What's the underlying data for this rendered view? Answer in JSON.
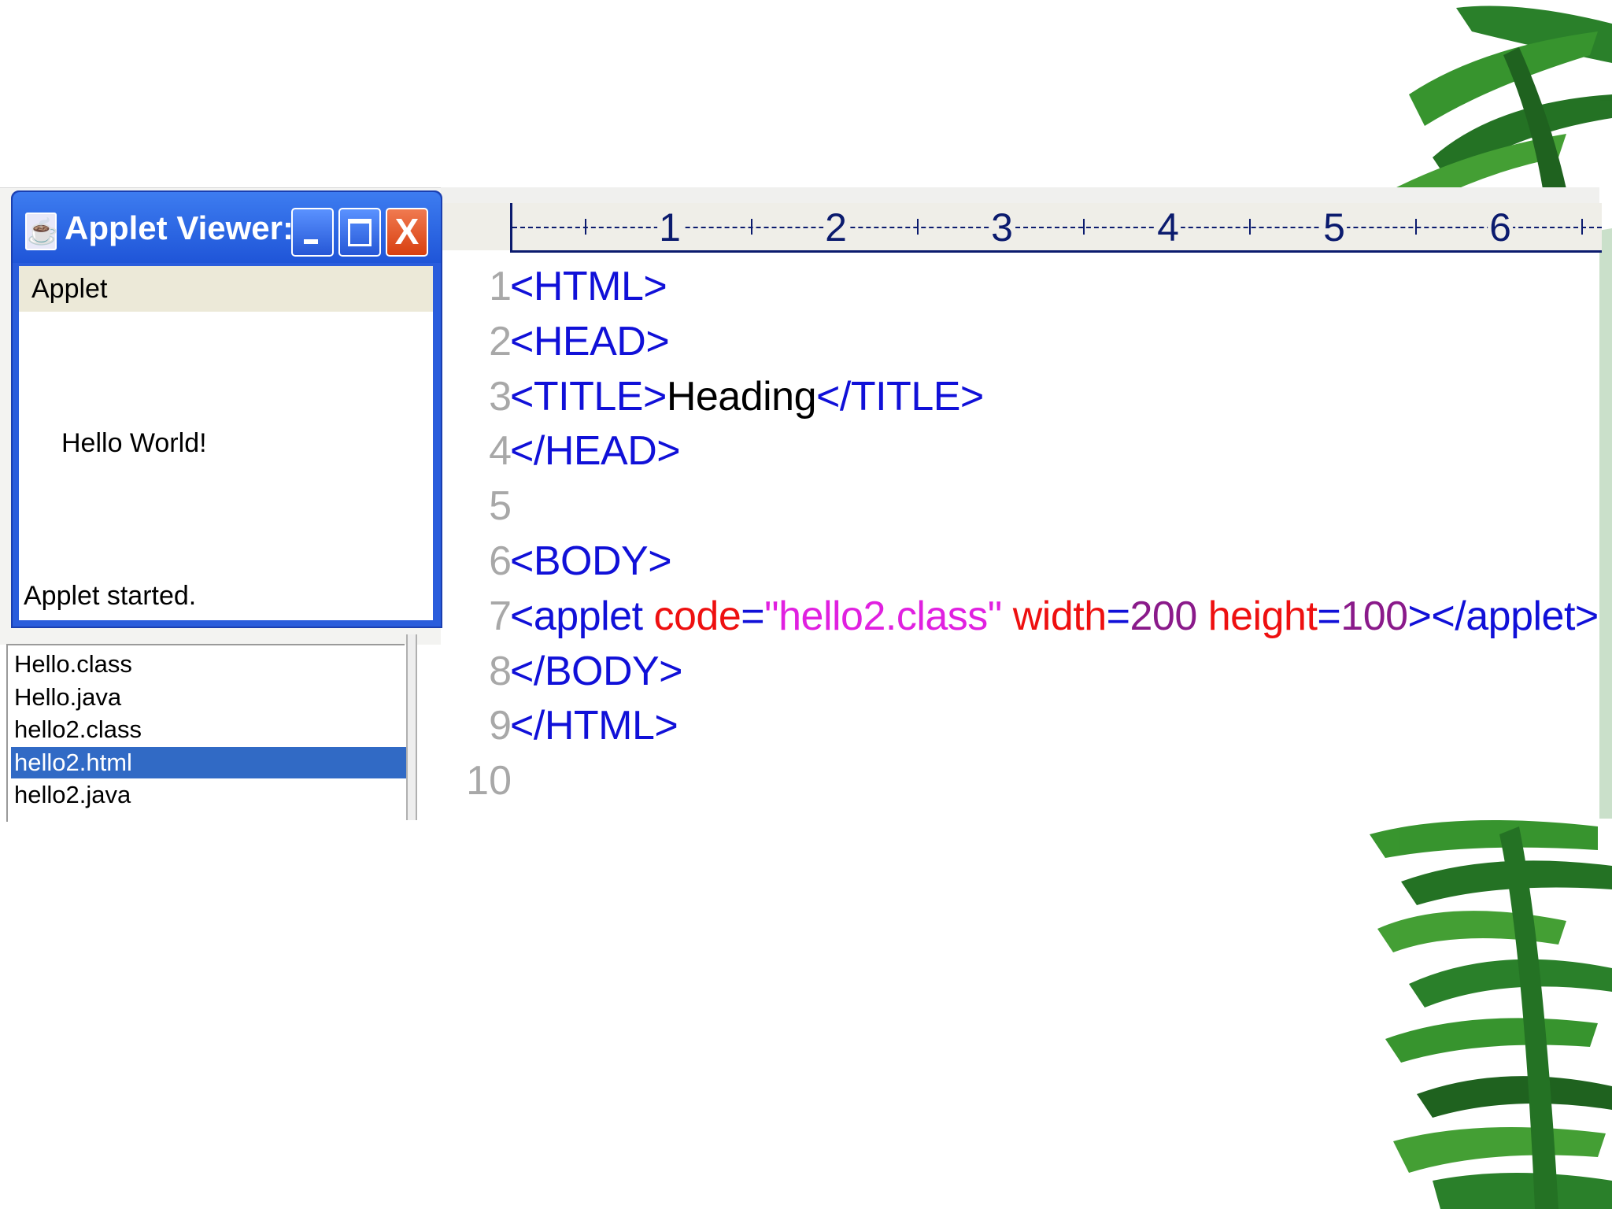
{
  "applet_viewer": {
    "title": "Applet Viewer:...",
    "menu": [
      "Applet"
    ],
    "content_text": "Hello World!",
    "status": "Applet started.",
    "controls": {
      "minimize": "_",
      "maximize": "□",
      "close": "X"
    }
  },
  "ruler": {
    "numbers": [
      "1",
      "2",
      "3",
      "4",
      "5",
      "6"
    ]
  },
  "editor": {
    "line_numbers": [
      "1",
      "2",
      "3",
      "4",
      "5",
      "6",
      "7",
      "8",
      "9",
      "10"
    ],
    "lines": [
      [
        {
          "t": "tag",
          "v": "<HTML>"
        }
      ],
      [
        {
          "t": "tag",
          "v": "<HEAD>"
        }
      ],
      [
        {
          "t": "tag",
          "v": "<TITLE>"
        },
        {
          "t": "txt",
          "v": "Heading"
        },
        {
          "t": "tag",
          "v": "</TITLE>"
        }
      ],
      [
        {
          "t": "tag",
          "v": "</HEAD>"
        }
      ],
      [],
      [
        {
          "t": "tag",
          "v": "<BODY>"
        }
      ],
      [
        {
          "t": "tag",
          "v": "<applet "
        },
        {
          "t": "attr",
          "v": "code"
        },
        {
          "t": "tag",
          "v": "="
        },
        {
          "t": "str",
          "v": "\"hello2.class\""
        },
        {
          "t": "tag",
          "v": " "
        },
        {
          "t": "attr",
          "v": "width"
        },
        {
          "t": "tag",
          "v": "="
        },
        {
          "t": "num",
          "v": "200"
        },
        {
          "t": "tag",
          "v": " "
        },
        {
          "t": "attr",
          "v": "height"
        },
        {
          "t": "tag",
          "v": "="
        },
        {
          "t": "num",
          "v": "100"
        },
        {
          "t": "tag",
          "v": "></applet>"
        }
      ],
      [
        {
          "t": "tag",
          "v": "</BODY>"
        }
      ],
      [
        {
          "t": "tag",
          "v": "</HTML>"
        }
      ],
      []
    ]
  },
  "file_list": {
    "items": [
      "Hello.class",
      "Hello.java",
      "hello2.class",
      "hello2.html",
      "hello2.java"
    ],
    "selected": "hello2.html"
  },
  "colors": {
    "tag": "#1010d8",
    "attribute": "#ee1010",
    "string": "#e020e0",
    "number": "#8a1a8a",
    "selection": "#316ac5",
    "titlebar": "#2a5ddc"
  }
}
